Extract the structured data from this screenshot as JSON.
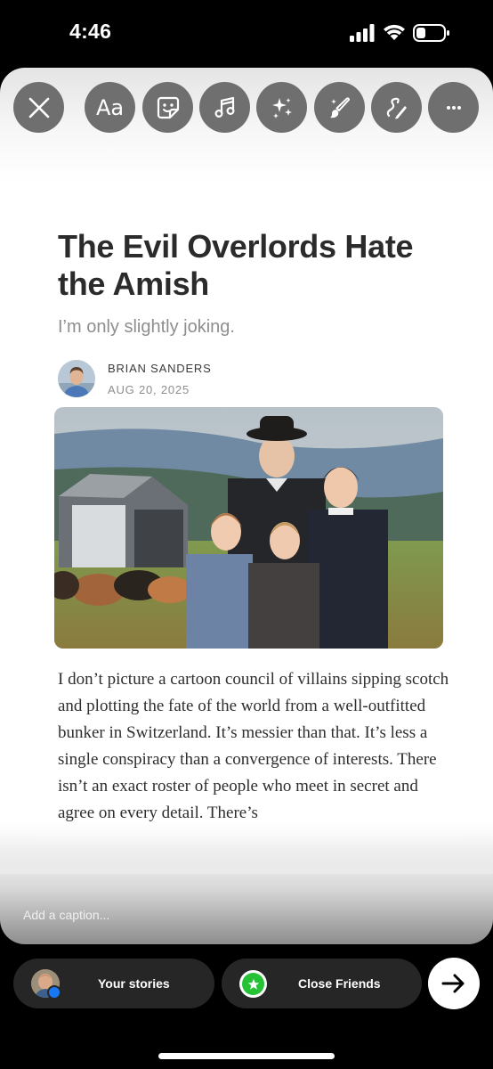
{
  "status_bar": {
    "time": "4:46"
  },
  "toolbar": {
    "close_icon": "close-icon",
    "text_label": "Aa",
    "tools": [
      "text-tool",
      "sticker-icon",
      "music-icon",
      "sparkles-icon",
      "magic-brush-icon",
      "draw-icon",
      "more-icon"
    ]
  },
  "article": {
    "title": "The Evil Overlords Hate the Amish",
    "subtitle": "I’m only slightly joking.",
    "author": "BRIAN SANDERS",
    "date": "AUG 20, 2025",
    "body": "I don’t picture a cartoon council of villains sipping scotch and plotting the fate of the world from a well-outfitted bunker in Switzerland. It’s messier than that. It’s less a single conspiracy than a convergence of interests. There isn’t an exact roster of people who meet in secret and agree on every detail. There’s"
  },
  "caption": {
    "placeholder": "Add a caption..."
  },
  "share": {
    "your_stories_label": "Your stories",
    "close_friends_label": "Close Friends"
  },
  "colors": {
    "tool_button_bg": "#6f6f6f",
    "pill_bg": "#262626",
    "close_friends_green": "#25c236",
    "facebook_blue": "#1877f2"
  }
}
